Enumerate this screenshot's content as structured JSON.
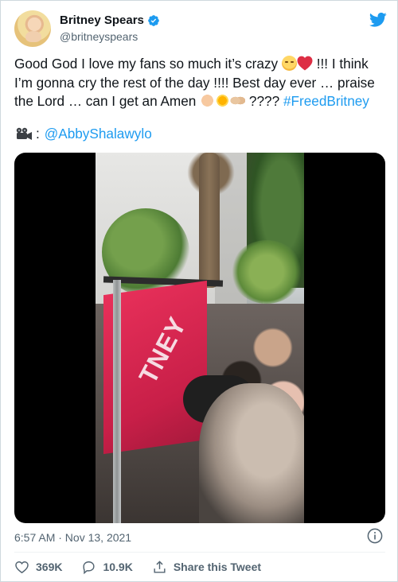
{
  "tweet": {
    "display_name": "Britney Spears",
    "handle": "@britneyspears",
    "text_part1": "Good God I love my fans so much it’s crazy",
    "text_part2": "!!! I think I’m gonna cry the rest of the day !!!! Best day ever … praise the Lord … can I get an Amen",
    "text_part3": "????",
    "hashtag": "#FreedBritney",
    "credit_prefix": ":",
    "credit_mention": "@AbbyShalawylo",
    "video_overlay_text": "TNEY",
    "timestamp": "6:57 AM · Nov 13, 2021"
  },
  "actions": {
    "likes": "369K",
    "replies": "10.9K",
    "share_label": "Share this Tweet"
  },
  "icons": {
    "verified": "verified-badge-icon",
    "bird": "twitter-bird-icon",
    "camera": "movie-camera-icon",
    "info": "info-icon",
    "heart": "heart-icon",
    "reply": "reply-bubble-icon",
    "share": "share-icon"
  },
  "colors": {
    "link": "#1d9bf0",
    "text": "#0f1419",
    "muted": "#536471",
    "border": "#cfd9de"
  }
}
